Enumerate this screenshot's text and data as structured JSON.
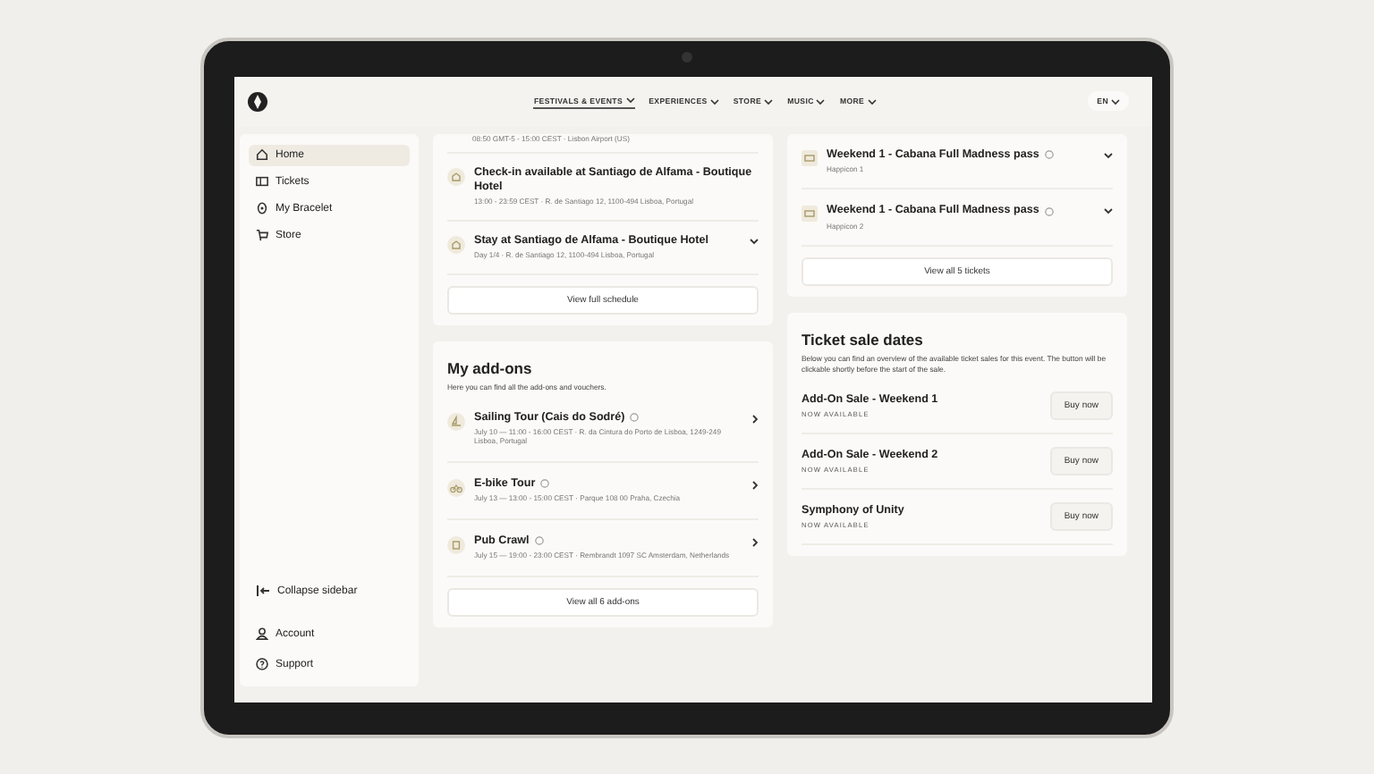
{
  "header": {
    "nav": [
      {
        "label": "FESTIVALS & EVENTS",
        "selected": true
      },
      {
        "label": "EXPERIENCES",
        "selected": false
      },
      {
        "label": "STORE",
        "selected": false
      },
      {
        "label": "MUSIC",
        "selected": false
      },
      {
        "label": "MORE",
        "selected": false
      }
    ],
    "language": "EN"
  },
  "sidebar": {
    "items": [
      {
        "kind": "home",
        "label": "Home",
        "selected": true
      },
      {
        "kind": "tickets",
        "label": "Tickets",
        "selected": false
      },
      {
        "kind": "bracelet",
        "label": "My Bracelet",
        "selected": false
      },
      {
        "kind": "store",
        "label": "Store",
        "selected": false
      }
    ],
    "collapse": "Collapse sidebar",
    "footer": [
      {
        "kind": "account",
        "label": "Account"
      },
      {
        "kind": "support",
        "label": "Support"
      }
    ]
  },
  "schedule": {
    "items": [
      {
        "kind": "partial",
        "subtitle": "08:50 GMT-5 - 15:00 CEST · Lisbon Airport (US)"
      },
      {
        "kind": "plain",
        "title": "Check-in available at Santiago de Alfama - Boutique Hotel",
        "subtitle": "13:00 - 23:59 CEST · R. de Santiago 12, 1100-494 Lisboa, Portugal"
      },
      {
        "kind": "expandable",
        "title": "Stay at Santiago de Alfama - Boutique Hotel",
        "subtitle": "Day 1/4 · R. de Santiago 12, 1100-494 Lisboa, Portugal"
      }
    ],
    "button": "View full schedule"
  },
  "addons": {
    "title": "My add-ons",
    "description": "Here you can find all the add-ons and vouchers.",
    "items": [
      {
        "kind": "boat",
        "title": "Sailing Tour (Cais do Sodré)",
        "subtitle": "July 10 — 11:00 - 16:00 CEST · R. da Cintura do Porto de Lisboa, 1249-249 Lisboa, Portugal"
      },
      {
        "kind": "bike",
        "title": "E-bike Tour",
        "subtitle": "July 13 — 13:00 - 15:00 CEST · Parque 108 00 Praha, Czechia"
      },
      {
        "kind": "drink",
        "title": "Pub Crawl",
        "subtitle": "July 15 — 19:00 - 23:00 CEST · Rembrandt 1097 SC Amsterdam, Netherlands"
      }
    ],
    "button": "View all 6 add-ons"
  },
  "tickets": {
    "items": [
      {
        "title": "Weekend 1 - Cabana Full Madness pass",
        "subtitle": "Happicon 1"
      },
      {
        "title": "Weekend 1 - Cabana Full Madness pass",
        "subtitle": "Happicon 2"
      }
    ],
    "button": "View all 5 tickets"
  },
  "sales": {
    "title": "Ticket sale dates",
    "description": "Below you can find an overview of the available ticket sales for this event. The button will be clickable shortly before the start of the sale.",
    "items": [
      {
        "title": "Add-On Sale - Weekend 1",
        "status": "NOW AVAILABLE",
        "button": "Buy now"
      },
      {
        "title": "Add-On Sale - Weekend 2",
        "status": "NOW AVAILABLE",
        "button": "Buy now"
      },
      {
        "title": "Symphony of Unity",
        "status": "NOW AVAILABLE",
        "button": "Buy now"
      }
    ]
  }
}
